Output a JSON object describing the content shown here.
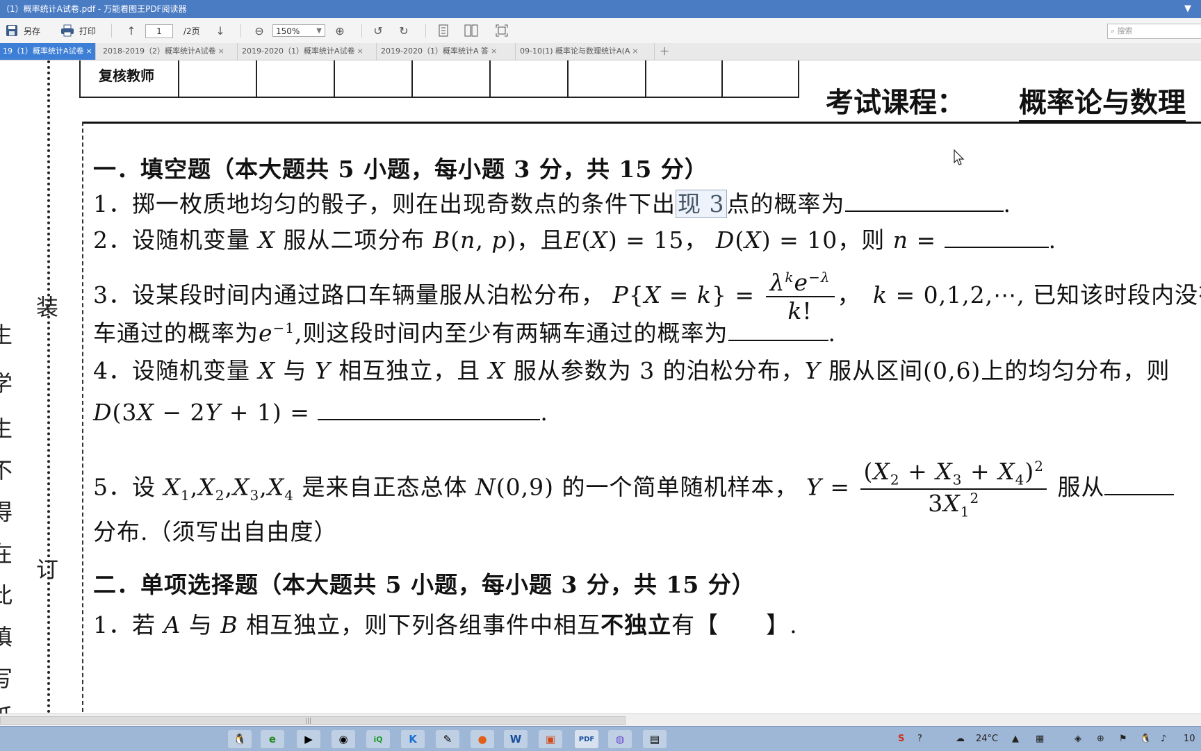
{
  "window": {
    "title": "（1）概率统计A试卷.pdf - 万能看图王PDF阅读器"
  },
  "toolbar": {
    "save_as": "另存",
    "print": "打印",
    "page_current": "1",
    "page_total": "/2页",
    "zoom": "150%",
    "search_placeholder": "搜索"
  },
  "tabs": [
    {
      "label": "19（1）概率统计A试卷",
      "active": true
    },
    {
      "label": "2018-2019（2）概率统计A试卷",
      "active": false
    },
    {
      "label": "2019-2020（1）概率统计A试卷",
      "active": false
    },
    {
      "label": "2019-2020（1）概率统计A 答",
      "active": false
    },
    {
      "label": "09-10(1) 概率论与数理统计A(A",
      "active": false
    }
  ],
  "document": {
    "side_marks": [
      "装",
      "订"
    ],
    "left_edge_chars": [
      "生",
      "：",
      "学",
      "生",
      "不",
      "得",
      "在",
      "此",
      "填",
      "写",
      "纸"
    ],
    "reviewer": "复核教师",
    "course_label": "考试课程：",
    "course_name": "概率论与数理",
    "section1": "一．填空题（本大题共 5 小题，每小题 3 分，共 15 分）",
    "q1_a": "1．掷一枚质地均匀的骰子，则在出现奇数点的条件下出",
    "q1_hl": "现 3",
    "q1_b": "点的概率为",
    "q2_a": "2．设随机变量",
    "q2_b": "服从二项分布",
    "q2_c": "，且",
    "q2_d": "，",
    "q2_e": "，则",
    "q3_a": "3．设某段时间内通过路口车辆量服从泊松分布，",
    "q3_b": "已知该时段内没有",
    "q3_c": "车通过的概率为",
    "q3_d": ",则这段时间内至少有两辆车通过的概率为",
    "q4_a": "4．设随机变量",
    "q4_b": "与",
    "q4_c": "相互独立，且",
    "q4_d": "服从参数为 3 的泊松分布，",
    "q4_e": "服从区间",
    "q4_f": "上的均匀分布，则",
    "q5_a": "5．设",
    "q5_b": "是来自正态总体",
    "q5_c": "的一个简单随机样本，",
    "q5_d": "服从",
    "q5_e": "分布.（须写出自由度）",
    "section2": "二．单项选择题（本大题共 5 小题，每小题 3 分，共 15 分）",
    "s2q1_a": "1．若",
    "s2q1_b": "与",
    "s2q1_c": "相互独立，则下列各组事件中相互",
    "s2q1_d": "不独立",
    "s2q1_e": "有【　　】."
  },
  "taskbar": {
    "temperature": "24°C",
    "clock": "10"
  }
}
